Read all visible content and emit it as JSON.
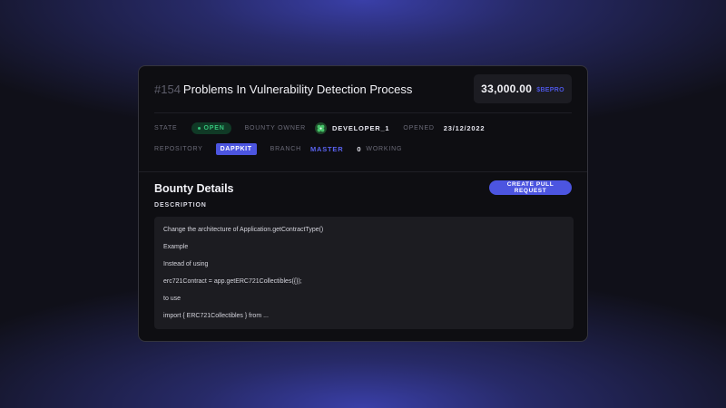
{
  "issue": {
    "number": "#154",
    "title": "Problems In Vulnerability Detection Process"
  },
  "price": {
    "amount": "33,000.00",
    "currency": "$BEPRO"
  },
  "meta": {
    "state_label": "STATE",
    "state_value": "OPEN",
    "owner_label": "BOUNTY OWNER",
    "owner_value": "DEVELOPER_1",
    "opened_label": "OPENED",
    "opened_value": "23/12/2022",
    "repo_label": "REPOSITORY",
    "repo_value": "DAPPKIT",
    "branch_label": "BRANCH",
    "branch_value": "MASTER",
    "working_count": "0",
    "working_label": "WORKING"
  },
  "details": {
    "title": "Bounty Details",
    "pr_button": "CREATE PULL REQUEST",
    "description_label": "DESCRIPTION",
    "lines": [
      "Change the architecture of Application.getContractType()",
      "Example",
      "Instead of using",
      "erc721Contract = app.getERC721Collectibles({});",
      "to use",
      "import { ERC721Collectibles } from ..."
    ]
  },
  "colors": {
    "accent": "#4c55e0",
    "open_green": "#35c37a",
    "card_bg": "#0e0e12"
  }
}
